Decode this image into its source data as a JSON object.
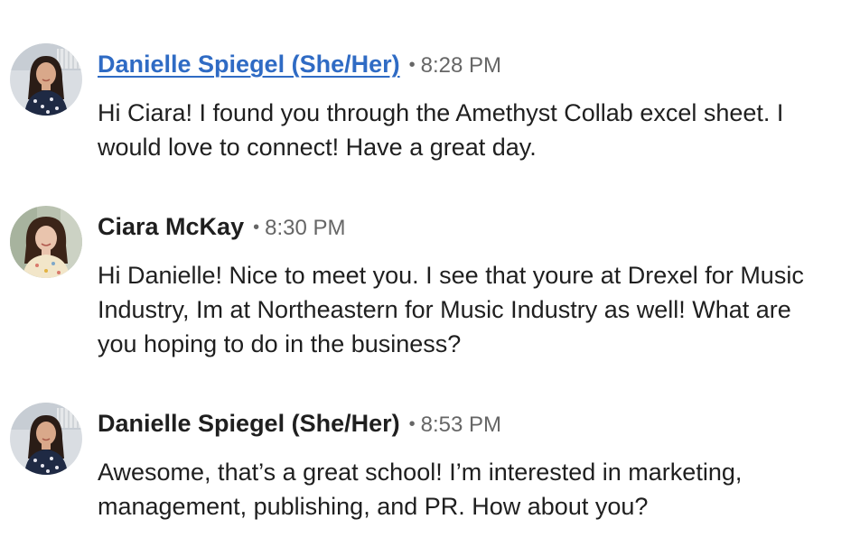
{
  "messages": [
    {
      "sender": "Danielle Spiegel (She/Her) ",
      "time": "8:28 PM",
      "separator": "•",
      "avatar": "danielle-avatar",
      "lines": [
        "Hi Ciara! I found you through the Amethyst Collab excel sheet. I",
        "would love to connect! Have a great day."
      ]
    },
    {
      "sender": "Ciara McKay",
      "time": "8:30 PM",
      "separator": "•",
      "avatar": "ciara-avatar",
      "lines": [
        "Hi Danielle! Nice to meet you. I see that youre at Drexel for Music",
        "Industry, Im at Northeastern for Music Industry as well! What are",
        "you hoping to do in the business?"
      ]
    },
    {
      "sender": "Danielle Spiegel (She/Her)",
      "time": "8:53 PM",
      "separator": "•",
      "avatar": "danielle-avatar",
      "lines": [
        "Awesome, that’s a great school! I’m interested in marketing,",
        "management, publishing, and PR. How about you?"
      ]
    }
  ],
  "colors": {
    "link": "#2f6bc4",
    "text": "#1f1f1f",
    "meta": "#666666"
  }
}
